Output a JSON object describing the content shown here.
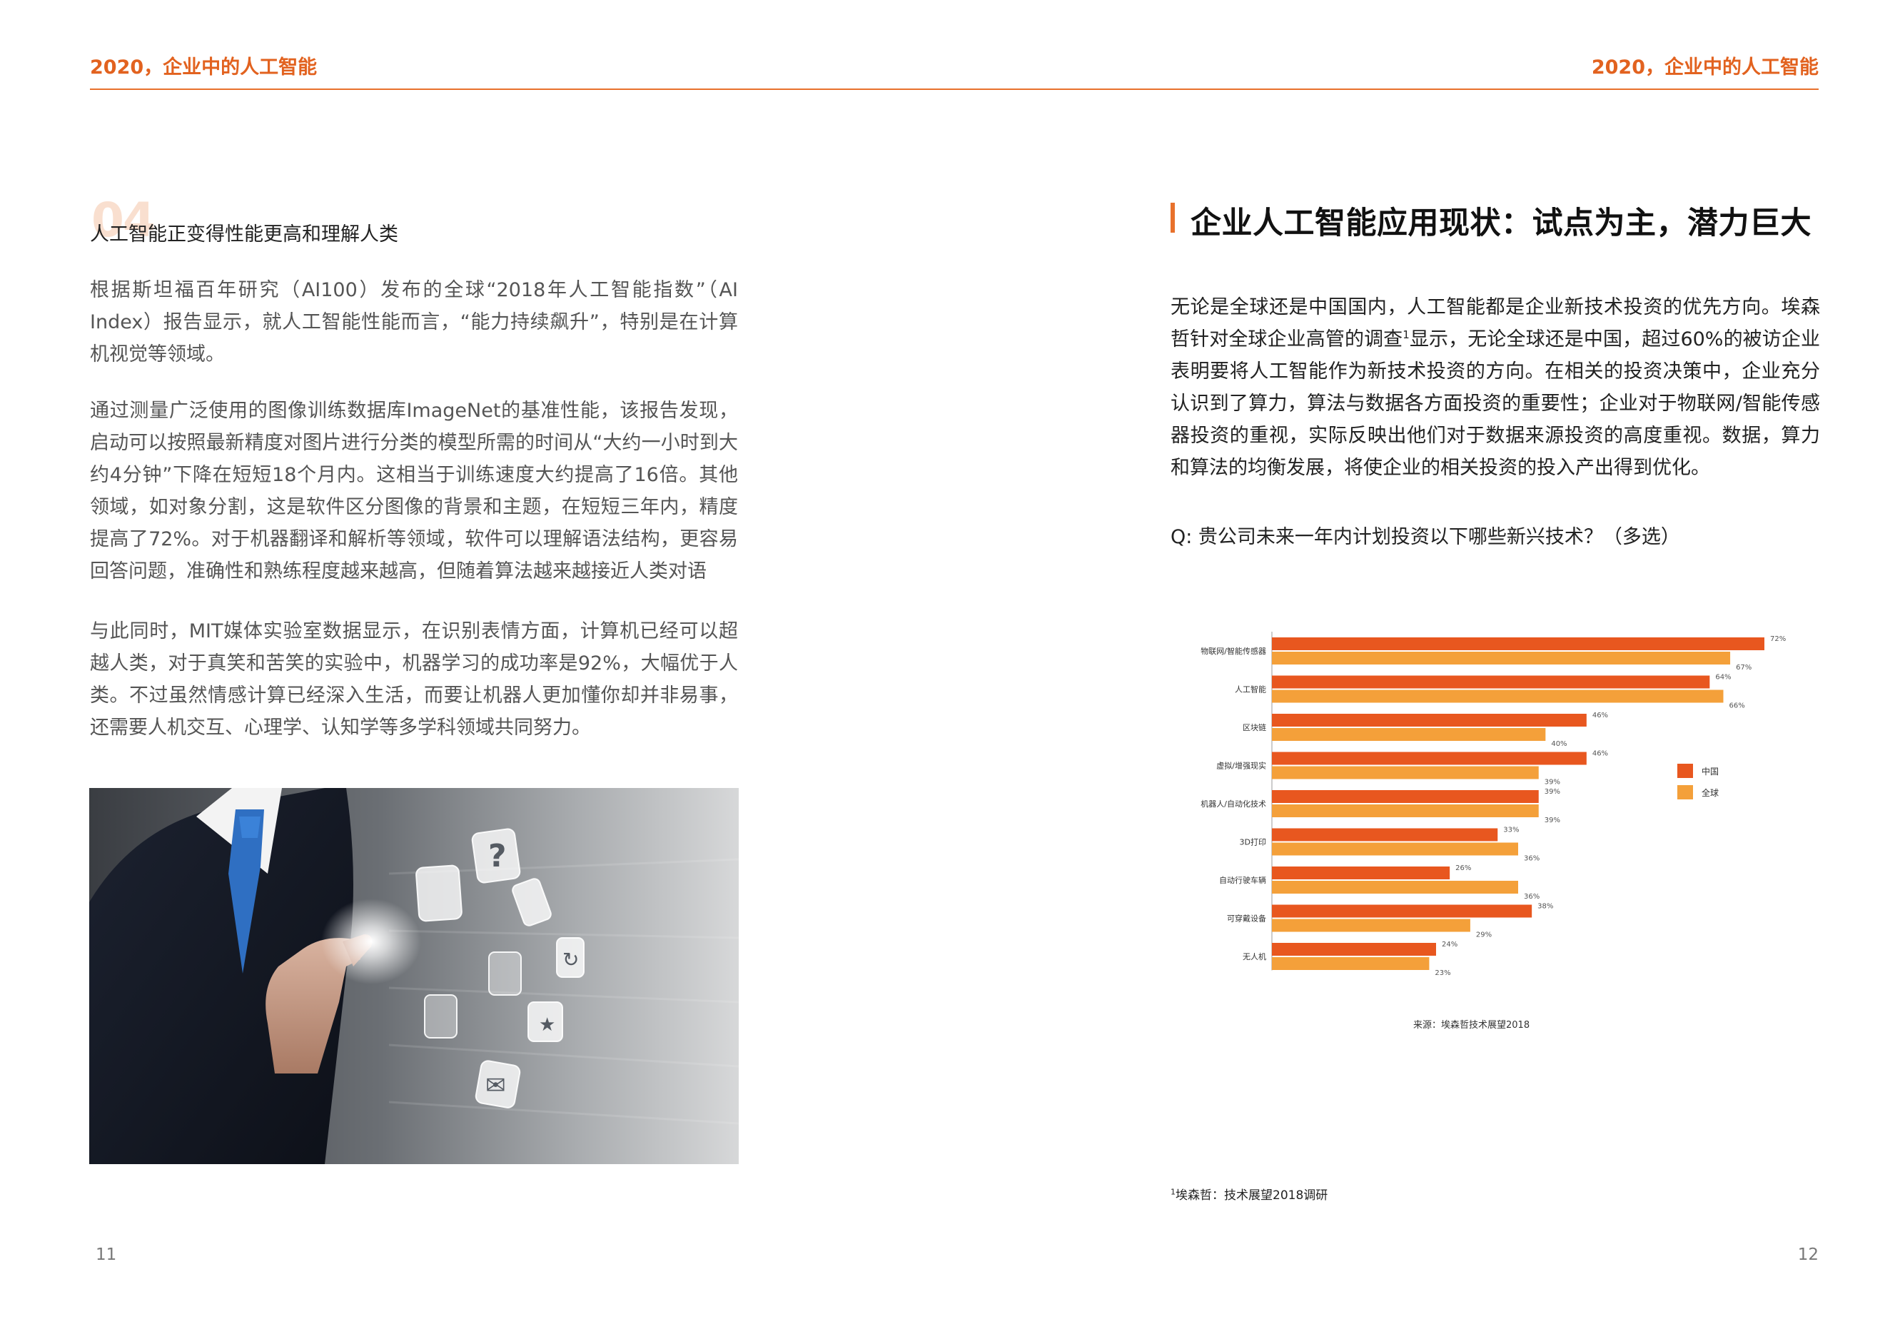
{
  "header": {
    "left_title": "2020，企业中的人工智能",
    "right_title": "2020，企业中的人工智能"
  },
  "left_page": {
    "section_number": "04",
    "subheading": "人工智能正变得性能更高和理解人类",
    "paragraphs": [
      "根据斯坦福百年研究（AI100）发布的全球“2018年人工智能指数”（AI Index）报告显示，就人工智能性能而言，“能力持续飙升”，特别是在计算机视觉等领域。",
      "通过测量广泛使用的图像训练数据库ImageNet的基准性能，该报告发现，启动可以按照最新精度对图片进行分类的模型所需的时间从“大约一小时到大约4分钟”下降在短短18个月内。这相当于训练速度大约提高了16倍。其他领域，如对象分割，这是软件区分图像的背景和主题，在短短三年内，精度提高了72%。对于机器翻译和解析等领域，软件可以理解语法结构，更容易回答问题，准确性和熟练程度越来越高，但随着算法越来越接近人类对语",
      "与此同时，MIT媒体实验室数据显示，在识别表情方面，计算机已经可以超越人类，对于真笑和苦笑的实验中，机器学习的成功率是92%，大幅优于人类。不过虽然情感计算已经深入生活，而要让机器人更加懂你却并非易事，还需要人机交互、心理学、认知学等多学科领域共同努力。"
    ],
    "page_number": "11"
  },
  "right_page": {
    "title": "企业人工智能应用现状：试点为主，潜力巨大",
    "paragraph_before_ref": "无论是全球还是中国国内，人工智能都是企业新技术投资的优先方向。埃森哲针对全球企业高管的调查",
    "ref_mark": "1",
    "paragraph_after_ref": "显示，无论全球还是中国，超过60%的被访企业表明要将人工智能作为新技术投资的方向。在相关的投资决策中，企业充分认识到了算力，算法与数据各方面投资的重要性；企业对于物联网/智能传感器投资的重视，实际反映出他们对于数据来源投资的高度重视。数据，算力和算法的均衡发展，将使企业的相关投资的投入产出得到优化。",
    "question": "Q: 贵公司未来一年内计划投资以下哪些新兴技术？（多选）",
    "footnote_mark": "1",
    "footnote": "埃森哲：技术展望2018调研",
    "page_number": "12"
  },
  "chart_data": {
    "type": "bar",
    "orientation": "horizontal",
    "categories": [
      "物联网/智能传感器",
      "人工智能",
      "区块链",
      "虚拟/增强现实",
      "机器人/自动化技术",
      "3D打印",
      "自动行驶车辆",
      "可穿戴设备",
      "无人机"
    ],
    "series": [
      {
        "name": "中国",
        "values": [
          72,
          64,
          46,
          46,
          39,
          33,
          26,
          38,
          24
        ],
        "color": "#e8571f"
      },
      {
        "name": "全球",
        "values": [
          67,
          66,
          40,
          39,
          39,
          36,
          36,
          29,
          23
        ],
        "color": "#f4a03a"
      }
    ],
    "value_suffix": "%",
    "xlim": [
      0,
      72
    ],
    "legend_position": "right",
    "grid": false,
    "source": "来源：埃森哲技术展望2018"
  },
  "colors": {
    "accent": "#e8712c",
    "china": "#e8571f",
    "global": "#f4a03a"
  },
  "photo": {
    "icons": [
      "question-icon",
      "phone-icon",
      "refresh-icon",
      "star-icon",
      "mail-icon",
      "at-icon"
    ]
  }
}
